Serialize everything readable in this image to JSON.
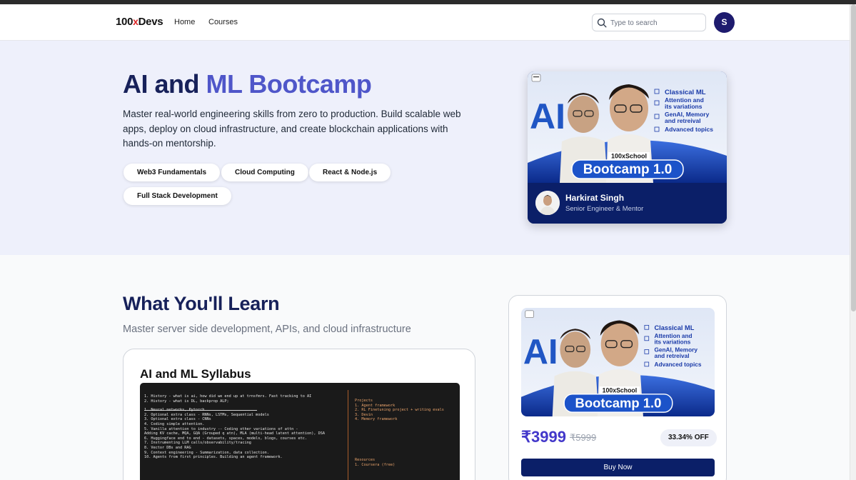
{
  "header": {
    "logo_prefix": "100",
    "logo_x": "x",
    "logo_suffix": "Devs",
    "nav": [
      "Home",
      "Courses"
    ],
    "search_placeholder": "Type to search",
    "user_initial": "S"
  },
  "hero": {
    "title_part1": "AI and",
    "title_part2": "ML",
    "title_part3": "Bootcamp",
    "description": "Master real-world engineering skills from zero to production. Build scalable web apps, deploy on cloud infrastructure, and create blockchain applications with hands-on mentorship.",
    "tags": [
      "Web3 Fundamentals",
      "Cloud Computing",
      "React & Node.js",
      "Full Stack Development"
    ]
  },
  "thumbnail": {
    "big_text": "AI",
    "topics": [
      "Classical ML",
      "Attention and its variations",
      "GenAI, Memory and retreival",
      "Advanced topics"
    ],
    "school": "100xSchool",
    "bootcamp": "Bootcamp 1.0"
  },
  "instructor": {
    "name": "Harkirat Singh",
    "role": "Senior Engineer & Mentor"
  },
  "learn": {
    "title": "What You'll Learn",
    "subtitle": "Master server side development, APIs, and cloud infrastructure"
  },
  "syllabus": {
    "title": "AI and ML Syllabus",
    "history": [
      "1. History  - what is ai, how did we end up at trnsfmrs. Fast tracking to AI",
      "2. History - what is DL, backprop ALP;"
    ],
    "topics": [
      "1. Neural networks, Pytorch",
      "2. Optional extra class - RNNs, LSTMs, Sequential models",
      "3. Optional extra class - CNNs",
      "4. Coding simple attention.",
      "5. Vanilla attention to industry -- Coding other variations of attn -",
      "   Adding KV cache, MQA, GQA (Grouped q atn), MLA (multi-head latent attention), DSA",
      "6. Huggingface end to end - datasets, spaces, models, blogs, courses etc.",
      "7. Instrumenting LLM calls/observability/tracing",
      "8. Vector DBs and RAG",
      "9. Context engineering - Summarization, data collection.",
      "10. Agents from first principles. Building an agent framework."
    ],
    "projects_title": "Projects",
    "projects": [
      "1. Agent framework",
      "2. RL Finetuning project + writing evals",
      "3. Devin",
      "4. Memory framework"
    ],
    "resources_title": "Resources",
    "resources": [
      "1. Coursera (free)"
    ]
  },
  "pricing": {
    "price": "₹3999",
    "old_price": "₹5999",
    "discount": "33.34% OFF",
    "buy_label": "Buy Now"
  },
  "colors": {
    "brand_navy": "#0b1f68",
    "title_dark": "#17215a",
    "title_accent": "#4f56c9",
    "price_accent": "#4338ca",
    "hero_bg": "#eef0fb"
  }
}
